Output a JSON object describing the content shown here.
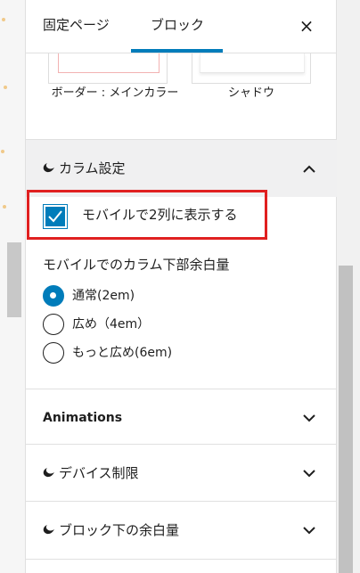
{
  "tabs": {
    "page": "固定ページ",
    "block": "ブロック",
    "close_icon": "×"
  },
  "style_variations": [
    {
      "label": "ボーダー : メインカラー"
    },
    {
      "label": "シャドウ"
    }
  ],
  "column_settings": {
    "title": "カラム設定",
    "chevron_icon": "chevron-up",
    "mobile_two_columns": {
      "label": "モバイルで2列に表示する",
      "checked": true
    },
    "bottom_margin": {
      "title": "モバイルでのカラム下部余白量",
      "options": [
        {
          "label": "通常(2em)",
          "checked": true
        },
        {
          "label": "広め（4em）",
          "checked": false
        },
        {
          "label": "もっと広め(6em)",
          "checked": false
        }
      ]
    }
  },
  "panels": [
    {
      "title": "Animations",
      "brand_icon": false
    },
    {
      "title": "デバイス制限",
      "brand_icon": true
    },
    {
      "title": "ブロック下の余白量",
      "brand_icon": true
    }
  ],
  "colors": {
    "accent": "#007cba",
    "highlight": "#e02020"
  }
}
